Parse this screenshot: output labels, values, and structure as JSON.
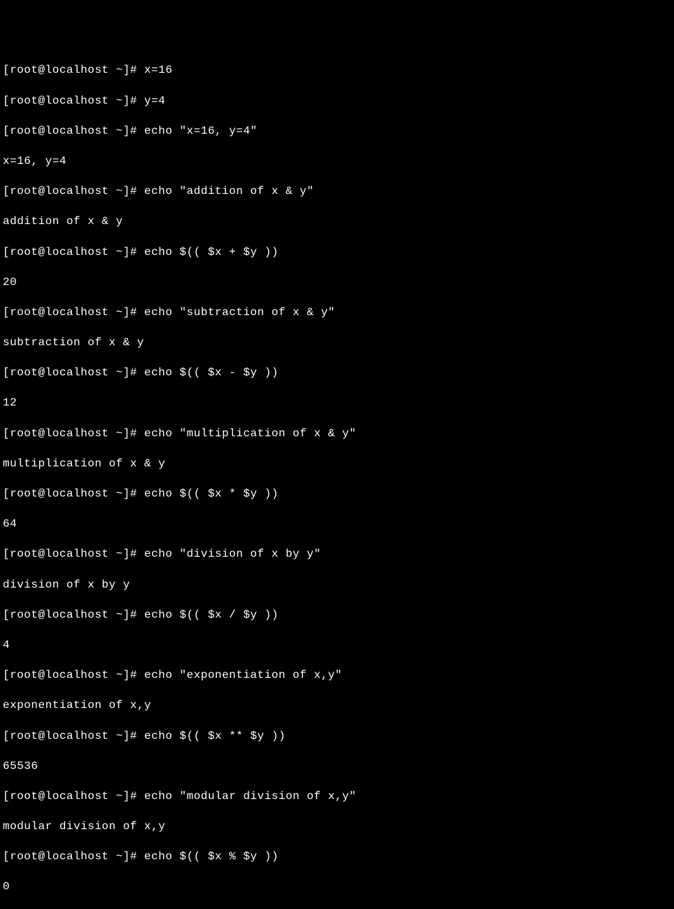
{
  "prompt": "[root@localhost ~]# ",
  "lines": [
    {
      "type": "cmd",
      "text": "x=16"
    },
    {
      "type": "cmd",
      "text": "y=4"
    },
    {
      "type": "cmd",
      "text": "echo \"x=16, y=4\""
    },
    {
      "type": "out",
      "text": "x=16, y=4"
    },
    {
      "type": "cmd",
      "text": "echo \"addition of x & y\""
    },
    {
      "type": "out",
      "text": "addition of x & y"
    },
    {
      "type": "cmd",
      "text": "echo $(( $x + $y ))"
    },
    {
      "type": "out",
      "text": "20"
    },
    {
      "type": "cmd",
      "text": "echo \"subtraction of x & y\""
    },
    {
      "type": "out",
      "text": "subtraction of x & y"
    },
    {
      "type": "cmd",
      "text": "echo $(( $x - $y ))"
    },
    {
      "type": "out",
      "text": "12"
    },
    {
      "type": "cmd",
      "text": "echo \"multiplication of x & y\""
    },
    {
      "type": "out",
      "text": "multiplication of x & y"
    },
    {
      "type": "cmd",
      "text": "echo $(( $x * $y ))"
    },
    {
      "type": "out",
      "text": "64"
    },
    {
      "type": "cmd",
      "text": "echo \"division of x by y\""
    },
    {
      "type": "out",
      "text": "division of x by y"
    },
    {
      "type": "cmd",
      "text": "echo $(( $x / $y ))"
    },
    {
      "type": "out",
      "text": "4"
    },
    {
      "type": "cmd",
      "text": "echo \"exponentiation of x,y\""
    },
    {
      "type": "out",
      "text": "exponentiation of x,y"
    },
    {
      "type": "cmd",
      "text": "echo $(( $x ** $y ))"
    },
    {
      "type": "out",
      "text": "65536"
    },
    {
      "type": "cmd",
      "text": "echo \"modular division of x,y\""
    },
    {
      "type": "out",
      "text": "modular division of x,y"
    },
    {
      "type": "cmd",
      "text": "echo $(( $x % $y ))"
    },
    {
      "type": "out",
      "text": "0"
    }
  ]
}
